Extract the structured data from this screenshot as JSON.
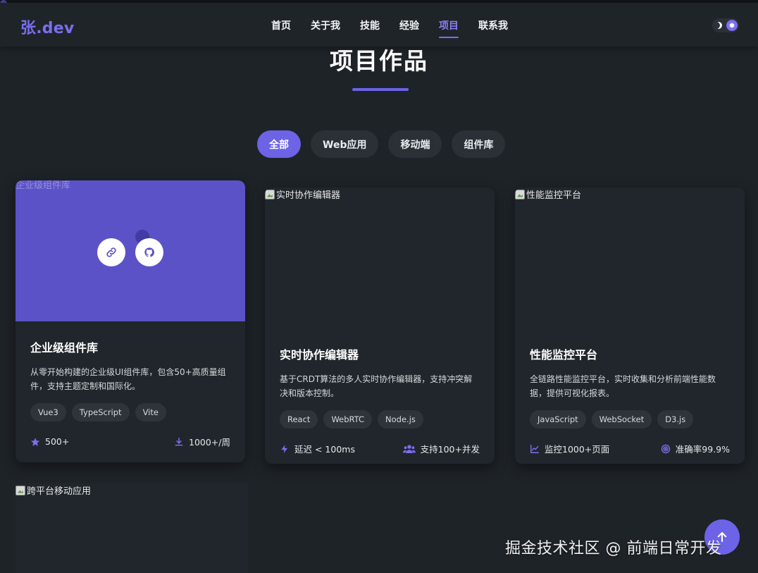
{
  "nav": {
    "logo": "张.dev",
    "links": [
      "首页",
      "关于我",
      "技能",
      "经验",
      "项目",
      "联系我"
    ],
    "active_index": 4,
    "theme_toggle_icons": [
      "moon-icon",
      "sun-icon"
    ]
  },
  "section": {
    "title": "项目作品"
  },
  "filters": [
    {
      "label": "全部",
      "active": true
    },
    {
      "label": "Web应用",
      "active": false
    },
    {
      "label": "移动端",
      "active": false
    },
    {
      "label": "组件库",
      "active": false
    }
  ],
  "projects": [
    {
      "image_alt": "企业级组件库",
      "title": "企业级组件库",
      "description": "从零开始构建的企业级UI组件库，包含50+高质量组件，支持主题定制和国际化。",
      "tags": [
        "Vue3",
        "TypeScript",
        "Vite"
      ],
      "stats": [
        {
          "icon": "star-icon",
          "text": "500+"
        },
        {
          "icon": "download-icon",
          "text": "1000+/周"
        }
      ],
      "overlay_icons": [
        "link-icon",
        "github-icon"
      ]
    },
    {
      "image_alt": "实时协作编辑器",
      "title": "实时协作编辑器",
      "description": "基于CRDT算法的多人实时协作编辑器，支持冲突解决和版本控制。",
      "tags": [
        "React",
        "WebRTC",
        "Node.js"
      ],
      "stats": [
        {
          "icon": "bolt-icon",
          "text": "延迟 < 100ms"
        },
        {
          "icon": "users-icon",
          "text": "支持100+并发"
        }
      ]
    },
    {
      "image_alt": "性能监控平台",
      "title": "性能监控平台",
      "description": "全链路性能监控平台，实时收集和分析前端性能数据，提供可视化报表。",
      "tags": [
        "JavaScript",
        "WebSocket",
        "D3.js"
      ],
      "stats": [
        {
          "icon": "chart-line-icon",
          "text": "监控1000+页面"
        },
        {
          "icon": "target-icon",
          "text": "准确率99.9%"
        }
      ]
    },
    {
      "image_alt": "跨平台移动应用"
    }
  ],
  "watermark": "掘金技术社区 @ 前端日常开发",
  "colors": {
    "background": "#1e2328",
    "card": "#20262b",
    "accent": "#6c63e6",
    "overlay": "#5b52c7"
  }
}
